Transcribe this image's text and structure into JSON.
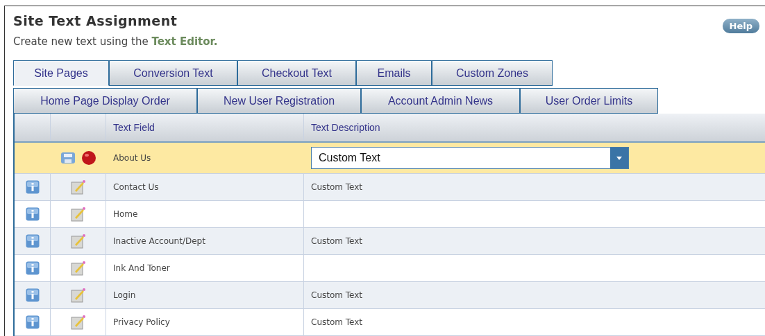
{
  "title": "Site Text Assignment",
  "subtitle": {
    "text": "Create new text using the",
    "link": "Text Editor."
  },
  "help_button": "Help",
  "tab_rows": [
    [
      {
        "label": "Site Pages",
        "selected": true
      },
      {
        "label": "Conversion Text",
        "selected": false
      },
      {
        "label": "Checkout Text",
        "selected": false
      },
      {
        "label": "Emails",
        "selected": false
      },
      {
        "label": "Custom Zones",
        "selected": false
      }
    ],
    [
      {
        "label": "Home Page Display Order",
        "selected": false
      },
      {
        "label": "New User Registration",
        "selected": false
      },
      {
        "label": "Account Admin News",
        "selected": false
      },
      {
        "label": "User Order Limits",
        "selected": false
      }
    ]
  ],
  "table": {
    "columns": [
      "Text Field",
      "Text Description"
    ],
    "rows": [
      {
        "kind": "editing",
        "field": "About Us",
        "description": "Custom Text"
      },
      {
        "kind": "view",
        "field": "Contact Us",
        "description": "Custom Text"
      },
      {
        "kind": "view",
        "field": "Home"
      },
      {
        "kind": "view",
        "field": "Inactive Account/Dept",
        "description": "Custom Text"
      },
      {
        "kind": "view",
        "field": "Ink And Toner"
      },
      {
        "kind": "view",
        "field": "Login",
        "description": "Custom Text"
      },
      {
        "kind": "view",
        "field": "Privacy Policy",
        "description": "Custom Text"
      }
    ]
  }
}
